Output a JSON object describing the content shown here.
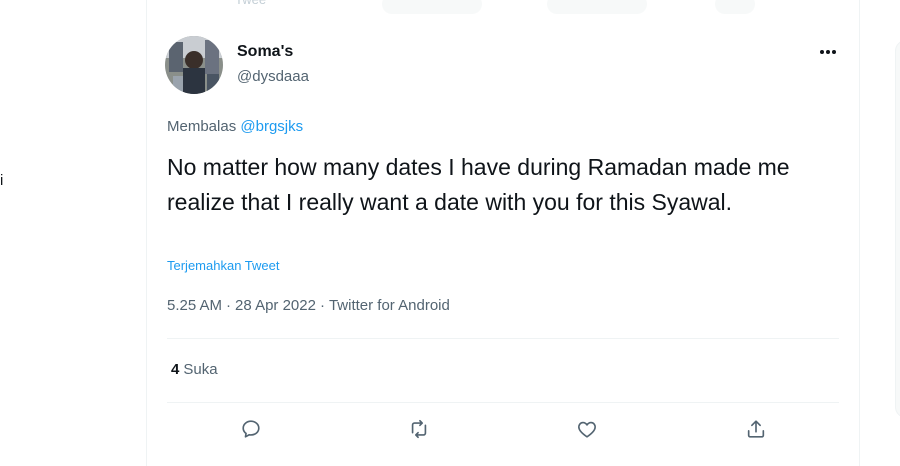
{
  "left": {
    "glyph": "i"
  },
  "top_remnant": {
    "text": "Twee"
  },
  "tweet": {
    "author_name": "Soma's",
    "author_handle": "@dysdaaa",
    "reply_prefix": "Membalas",
    "reply_to": "@brgsjks",
    "text": "No matter how many dates I have during Ramadan made me realize that I really want a date with you for this Syawal.",
    "translate_label": "Terjemahkan Tweet",
    "time": "5.25 AM",
    "date": "28 Apr 2022",
    "source": "Twitter for Android",
    "separator": "·",
    "likes_count": "4",
    "likes_label": "Suka"
  },
  "icons": {
    "reply": "speech-bubble-icon",
    "retweet": "retweet-arrows-icon",
    "like": "heart-icon",
    "share": "share-upload-icon",
    "more": "more-dots-icon"
  },
  "colors": {
    "text_primary": "#0f1419",
    "text_secondary": "#536471",
    "accent": "#1d9bf0",
    "divider": "#eff3f4"
  }
}
